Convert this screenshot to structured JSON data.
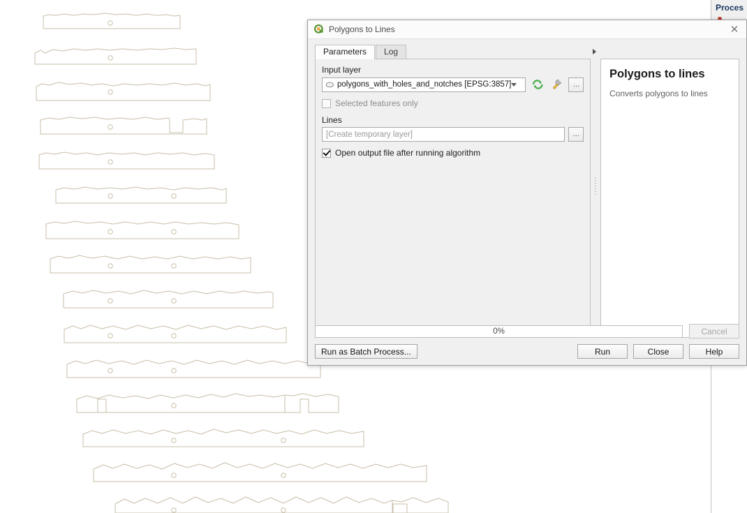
{
  "app": {
    "processing_panel_title": "Proces",
    "processing_items": [
      "",
      "",
      "",
      ""
    ]
  },
  "dialog": {
    "title": "Polygons to Lines",
    "window_icon": "qgis-logo-icon",
    "close_icon": "close-icon",
    "tabs": [
      {
        "label": "Parameters",
        "active": true
      },
      {
        "label": "Log",
        "active": false
      }
    ],
    "input_layer": {
      "label": "Input layer",
      "value": "polygons_with_holes_and_notches [EPSG:3857]",
      "layer_icon": "polygon-layer-icon",
      "iterate_icon": "iterate-over-features-icon",
      "advanced_icon": "wrench-icon",
      "more_button_label": "…"
    },
    "selected_features_only": {
      "label": "Selected features only",
      "checked": false,
      "enabled": false
    },
    "output": {
      "label": "Lines",
      "placeholder": "[Create temporary layer]",
      "value": "",
      "browse_button_label": "…"
    },
    "open_output": {
      "label": "Open output file after running algorithm",
      "checked": true
    },
    "help": {
      "title": "Polygons to lines",
      "description": "Converts polygons to lines"
    },
    "progress": {
      "percent_label": "0%",
      "value": 0
    },
    "buttons": {
      "cancel": "Cancel",
      "batch": "Run as Batch Process...",
      "run": "Run",
      "close": "Close",
      "help": "Help"
    }
  },
  "map": {
    "stroke_color": "#c9bfa8",
    "fill_color": "#ffffff",
    "background": "#ffffff",
    "feature_count": 16,
    "description": "Polygon features with interior ring holes and rectangular notches"
  }
}
